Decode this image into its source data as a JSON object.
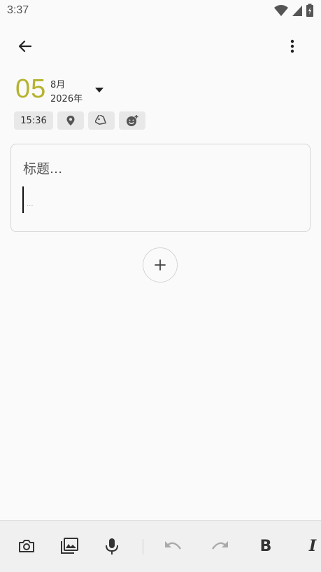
{
  "status_bar": {
    "time": "3:37"
  },
  "date": {
    "day": "05",
    "month": "8月",
    "year": "2026年"
  },
  "chips": {
    "time": "15:36"
  },
  "editor": {
    "title_placeholder": "标题...",
    "body_placeholder": "..."
  },
  "colors": {
    "accent": "#b5b32e",
    "background": "#fafafa",
    "chip_bg": "#e8e8e8",
    "toolbar_bg": "#f0f0f0"
  },
  "icons": {
    "back": "arrow-left-icon",
    "menu": "more-vert-icon",
    "dropdown": "caret-down-icon",
    "location": "location-pin-icon",
    "tag": "tag-icon",
    "mood": "mood-add-icon",
    "add": "plus-icon",
    "camera": "camera-icon",
    "gallery": "image-icon",
    "mic": "mic-icon",
    "undo": "undo-icon",
    "redo": "redo-icon",
    "bold": "bold-icon",
    "italic": "italic-icon"
  },
  "toolbar": {
    "bold_label": "B",
    "italic_label": "I"
  }
}
